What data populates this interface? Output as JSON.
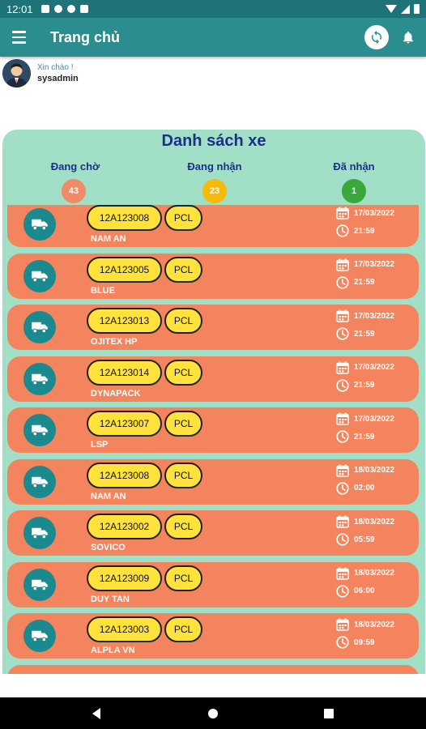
{
  "status_bar": {
    "time": "12:01"
  },
  "app_bar": {
    "title": "Trang chủ",
    "menu_icon": "menu-icon",
    "sync_icon": "sync-icon",
    "bell_icon": "bell-icon"
  },
  "greeting": {
    "hello": "Xin chào !",
    "username": "sysadmin"
  },
  "list": {
    "title": "Danh sách xe",
    "tabs": [
      {
        "label": "Đang chờ",
        "count": "43",
        "color": "#f08a68"
      },
      {
        "label": "Đang nhận",
        "count": "23",
        "color": "#f7b90a"
      },
      {
        "label": "Đã nhận",
        "count": "1",
        "color": "#3aa83a"
      }
    ],
    "rows": [
      {
        "plate": "12A123008",
        "type": "PCL",
        "company": "NAM AN",
        "date": "17/03/2022",
        "time": "21:59"
      },
      {
        "plate": "12A123005",
        "type": "PCL",
        "company": "BLUE",
        "date": "17/03/2022",
        "time": "21:59"
      },
      {
        "plate": "12A123013",
        "type": "PCL",
        "company": "OJITEX HP",
        "date": "17/03/2022",
        "time": "21:59"
      },
      {
        "plate": "12A123014",
        "type": "PCL",
        "company": "DYNAPACK",
        "date": "17/03/2022",
        "time": "21:59"
      },
      {
        "plate": "12A123007",
        "type": "PCL",
        "company": "LSP",
        "date": "17/03/2022",
        "time": "21:59"
      },
      {
        "plate": "12A123008",
        "type": "PCL",
        "company": "NAM AN",
        "date": "18/03/2022",
        "time": "02:00"
      },
      {
        "plate": "12A123002",
        "type": "PCL",
        "company": "SOVICO",
        "date": "18/03/2022",
        "time": "05:59"
      },
      {
        "plate": "12A123009",
        "type": "PCL",
        "company": "DUY TAN",
        "date": "18/03/2022",
        "time": "06:00"
      },
      {
        "plate": "12A123003",
        "type": "PCL",
        "company": "ALPLA VN",
        "date": "18/03/2022",
        "time": "09:59"
      }
    ]
  },
  "colors": {
    "primary": "#2c8d8e",
    "panel": "#a1e0c6",
    "row": "#f4845d",
    "pill": "#ffe33c",
    "title": "#1c2e8c"
  }
}
